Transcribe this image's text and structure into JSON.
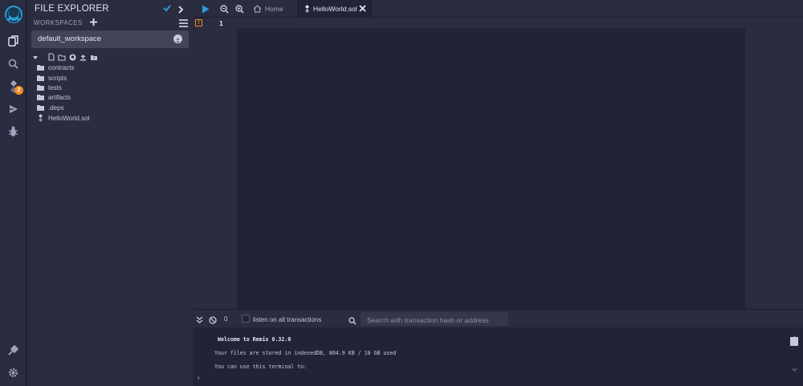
{
  "app": {
    "name": "Remix",
    "accent": "#2a9fd6",
    "warning": "#f38c1e"
  },
  "icon_panel": {
    "top": [
      "remix-logo-icon",
      "file-explorer-icon",
      "search-icon",
      "solidity-compiler-icon",
      "deploy-run-icon",
      "debugger-icon"
    ],
    "compiler_badge": "2",
    "bottom": [
      "plugin-manager-icon",
      "settings-icon"
    ]
  },
  "file_explorer": {
    "title": "FILE EXPLORER",
    "workspaces_label": "WORKSPACES",
    "selected_workspace": "default_workspace",
    "toolbar_icons": [
      "new-file-icon",
      "new-folder-icon",
      "github-icon",
      "upload-icon",
      "folder-upload-icon"
    ],
    "items": [
      {
        "label": "contracts",
        "type": "folder"
      },
      {
        "label": "scripts",
        "type": "folder"
      },
      {
        "label": "tests",
        "type": "folder"
      },
      {
        "label": "artifacts",
        "type": "folder"
      },
      {
        "label": ".deps",
        "type": "folder"
      },
      {
        "label": "HelloWorld.sol",
        "type": "solidity-file"
      }
    ]
  },
  "tabs": {
    "home_label": "Home",
    "active_label": "HelloWorld.sol"
  },
  "editor": {
    "line_number": "1"
  },
  "terminal": {
    "tx_count": "0",
    "listen_label": "listen on all transactions",
    "search_placeholder": "Search with transaction hash or address",
    "lines": [
      "Welcome to Remix 0.32.0",
      "Your files are stored in indexedDB, 804.9 KB / 10 GB used",
      "You can use this terminal to:"
    ],
    "prompt": "›"
  }
}
